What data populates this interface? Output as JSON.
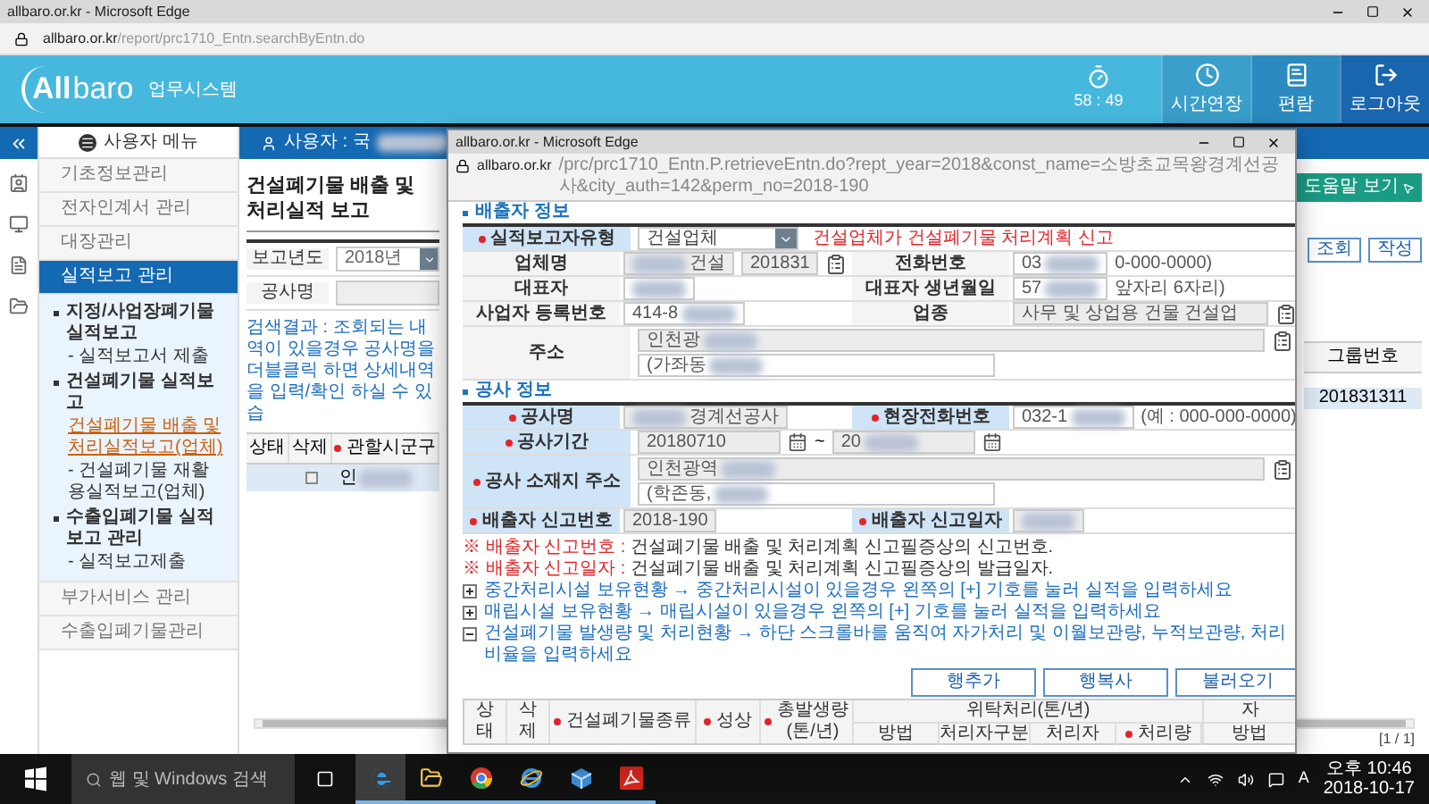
{
  "browser": {
    "title": "allbaro.or.kr - Microsoft Edge",
    "url_host": "allbaro.or.kr",
    "url_path": "/report/prc1710_Entn.searchByEntn.do"
  },
  "header": {
    "logo_left": "All",
    "logo_right": "baro",
    "system": "업무시스템",
    "timer": "58 : 49",
    "buttons": [
      {
        "label": "시간연장",
        "kind": "clock"
      },
      {
        "label": "편람",
        "kind": "book"
      },
      {
        "label": "로그아웃",
        "kind": "logout"
      }
    ]
  },
  "nav": {
    "menu_title": "사용자 메뉴",
    "user_label": "사용자 : 국"
  },
  "sidebar": {
    "items": [
      {
        "label": "기초정보관리",
        "selected": false
      },
      {
        "label": "전자인계서 관리",
        "selected": false
      },
      {
        "label": "대장관리",
        "selected": false
      },
      {
        "label": "실적보고 관리",
        "selected": true,
        "children": [
          {
            "label": "지정/사업장폐기물 실적보고",
            "children": [
              {
                "label": "- 실적보고서 제출",
                "selected": false
              }
            ]
          },
          {
            "label": "건설폐기물 실적보고",
            "children": [
              {
                "label": "건설폐기물 배출 및 처리실적보고(업체)",
                "selected": true
              },
              {
                "label": "- 건설폐기물 재활용실적보고(업체)",
                "selected": false
              }
            ]
          },
          {
            "label": "수출입폐기물 실적보고 관리",
            "children": [
              {
                "label": "- 실적보고제출",
                "selected": false
              }
            ]
          }
        ]
      },
      {
        "label": "부가서비스 관리",
        "selected": false
      },
      {
        "label": "수출입폐기물관리",
        "selected": false
      }
    ]
  },
  "page": {
    "title": "건설폐기물 배출 및 처리실적 보고",
    "help_button": "도움말 보기",
    "actions": [
      "조회",
      "작성"
    ],
    "search": [
      {
        "label": "보고년도",
        "kind": "select",
        "value": "2018년"
      },
      {
        "label": "공사명",
        "kind": "input"
      }
    ],
    "note": "검색결과 : 조회되는 내역이 있을경우 공사명을 더블클릭 하면 상세내역을 입력/확인 하실 수 있습",
    "table": {
      "columns": [
        {
          "label": "상태",
          "required": false
        },
        {
          "label": "삭제",
          "required": false
        },
        {
          "label": "관할시군구",
          "required": true
        }
      ],
      "right_column": "그룹번호",
      "rows": [
        {
          "selected": true,
          "checked": false,
          "district": "인",
          "redacted_after": true,
          "group_no": "201831311"
        }
      ]
    },
    "pagination": "[1 / 1]"
  },
  "popup": {
    "title": "allbaro.or.kr - Microsoft Edge",
    "url_host": "allbaro.or.kr",
    "url_path": "/prc/prc1710_Entn.P.retrieveEntn.do?rept_year=2018&const_name=소방초교목왕경계선공사&city_auth=142&perm_no=2018-190",
    "sections": [
      {
        "title": "배출자 정보",
        "rows": [
          {
            "kind": "type",
            "label": "실적보고자유형",
            "required": true,
            "value": "건설업체",
            "note": "건설업체가 건설폐기물 처리계획 신고"
          },
          {
            "kind": "pair",
            "cells": [
              {
                "label": "업체명",
                "required": false,
                "lookup": true,
                "fields": [
                  {
                    "value": "건설",
                    "redacted_before": true,
                    "readonly": true
                  },
                  {
                    "value": "201831",
                    "readonly": true
                  }
                ]
              },
              {
                "label": "전화번호",
                "required": false,
                "fields": [
                  {
                    "value": "03",
                    "redacted_after": true,
                    "readonly": false
                  }
                ],
                "hint": "0-000-0000)"
              }
            ]
          },
          {
            "kind": "pair",
            "cells": [
              {
                "label": "대표자",
                "required": false,
                "fields": [
                  {
                    "redacted_after": true,
                    "readonly": false
                  }
                ]
              },
              {
                "label": "대표자 생년월일",
                "required": false,
                "fields": [
                  {
                    "value": "57",
                    "redacted_after": true,
                    "readonly": false
                  }
                ],
                "hint": "앞자리 6자리)"
              }
            ]
          },
          {
            "kind": "pair",
            "cells": [
              {
                "label": "사업자 등록번호",
                "required": false,
                "fields": [
                  {
                    "value": "414-8",
                    "redacted_after": true,
                    "readonly": false
                  }
                ]
              },
              {
                "label": "업종",
                "required": false,
                "lookup": true,
                "fields": [
                  {
                    "value": "사무 및 상업용 건물 건설업",
                    "readonly": true
                  }
                ]
              }
            ]
          },
          {
            "kind": "address",
            "label": "주소",
            "required": false,
            "lookup": true,
            "fields": [
              {
                "value": "인천광",
                "redacted_after": true,
                "readonly": true
              },
              {
                "value": "(가좌동",
                "redacted_after": true,
                "readonly": false
              }
            ]
          }
        ]
      },
      {
        "title": "공사 정보",
        "rows": [
          {
            "kind": "pair",
            "cells": [
              {
                "label": "공사명",
                "required": true,
                "fields": [
                  {
                    "value": "경계선공사",
                    "redacted_before": true,
                    "readonly": true
                  }
                ]
              },
              {
                "label": "현장전화번호",
                "required": true,
                "fields": [
                  {
                    "value": "032-1",
                    "redacted_after": true,
                    "readonly": false
                  }
                ],
                "hint": "(예 : 000-000-0000)"
              }
            ]
          },
          {
            "kind": "period",
            "label": "공사기간",
            "required": true,
            "start": {
              "value": "20180710",
              "readonly": true
            },
            "separator": "~",
            "end": {
              "value": "20",
              "redacted_after": true,
              "readonly": true
            }
          },
          {
            "kind": "address",
            "label": "공사 소재지 주소",
            "required": true,
            "lookup": true,
            "fields": [
              {
                "value": "인천광역",
                "redacted_after": true,
                "readonly": true
              },
              {
                "value": "(학존동,",
                "redacted_after": true,
                "readonly": false
              }
            ]
          },
          {
            "kind": "pair",
            "cells": [
              {
                "label": "배출자 신고번호",
                "required": true,
                "fields": [
                  {
                    "value": "2018-190",
                    "readonly": true
                  }
                ]
              },
              {
                "label": "배출자 신고일자",
                "required": true,
                "fields": [
                  {
                    "redacted_after": true,
                    "readonly": true
                  }
                ]
              }
            ]
          }
        ]
      }
    ],
    "notes": [
      {
        "lead": "※ 배출자 신고번호 :",
        "text": "건설폐기물 배출 및 처리계획 신고필증상의 신고번호."
      },
      {
        "lead": "※ 배출자 신고일자 :",
        "text": "건설폐기물 배출 및 처리계획 신고필증상의 발급일자."
      }
    ],
    "expanders": [
      {
        "text": "중간처리시설 보유현황 → 중간처리시설이 있을경우 왼쪽의 [+] 기호를 눌러 실적을 입력하세요",
        "expanded": false
      },
      {
        "text": "매립시설 보유현황 → 매립시설이 있을경우 왼쪽의 [+] 기호를 눌러 실적을 입력하세요",
        "expanded": false
      },
      {
        "text": "건설폐기물 발생량 및 처리현황 → 하단 스크롤바를 움직여 자가처리 및 이월보관량, 누적보관량, 처리비율을 입력하세요",
        "expanded": true
      }
    ],
    "buttons": [
      "행추가",
      "행복사",
      "불러오기"
    ],
    "table": {
      "columns": [
        {
          "label": "상태",
          "required": false
        },
        {
          "label": "삭제",
          "required": false
        },
        {
          "label": "건설폐기물종류",
          "required": true
        },
        {
          "label": "성상",
          "required": true
        },
        {
          "label": "총발생량(톤/년)",
          "required": true
        }
      ],
      "groups": [
        {
          "label": "위탁처리(톤/년)",
          "columns": [
            {
              "label": "방법",
              "required": false
            },
            {
              "label": "처리자구분",
              "required": false
            },
            {
              "label": "처리자",
              "required": false
            },
            {
              "label": "처리량",
              "required": true
            }
          ]
        },
        {
          "label": "자",
          "columns": [
            {
              "label": "방법",
              "required": false
            }
          ]
        }
      ]
    }
  },
  "taskbar": {
    "search_placeholder": "웹 및 Windows 검색",
    "apps": [
      {
        "kind": "edge",
        "active": true
      },
      {
        "kind": "folder",
        "active": false
      },
      {
        "kind": "chrome",
        "active": false
      },
      {
        "kind": "ie",
        "active": false
      },
      {
        "kind": "box",
        "active": false
      },
      {
        "kind": "acrobat",
        "active": false
      }
    ],
    "ime": "A",
    "time": "오후 10:46",
    "date": "2018-10-17"
  }
}
